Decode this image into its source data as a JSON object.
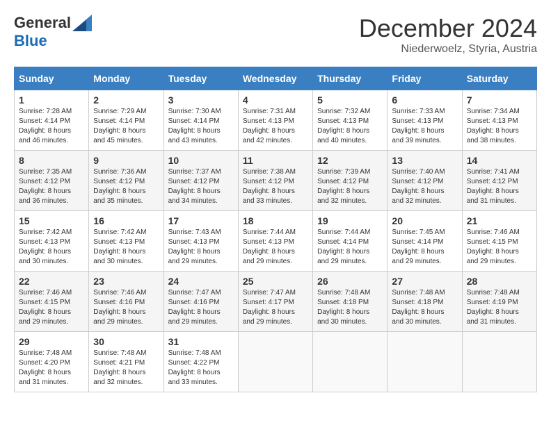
{
  "header": {
    "logo_general": "General",
    "logo_blue": "Blue",
    "month_title": "December 2024",
    "subtitle": "Niederwoelz, Styria, Austria"
  },
  "weekdays": [
    "Sunday",
    "Monday",
    "Tuesday",
    "Wednesday",
    "Thursday",
    "Friday",
    "Saturday"
  ],
  "weeks": [
    [
      {
        "day": "1",
        "sunrise": "7:28 AM",
        "sunset": "4:14 PM",
        "daylight": "8 hours and 46 minutes."
      },
      {
        "day": "2",
        "sunrise": "7:29 AM",
        "sunset": "4:14 PM",
        "daylight": "8 hours and 45 minutes."
      },
      {
        "day": "3",
        "sunrise": "7:30 AM",
        "sunset": "4:14 PM",
        "daylight": "8 hours and 43 minutes."
      },
      {
        "day": "4",
        "sunrise": "7:31 AM",
        "sunset": "4:13 PM",
        "daylight": "8 hours and 42 minutes."
      },
      {
        "day": "5",
        "sunrise": "7:32 AM",
        "sunset": "4:13 PM",
        "daylight": "8 hours and 40 minutes."
      },
      {
        "day": "6",
        "sunrise": "7:33 AM",
        "sunset": "4:13 PM",
        "daylight": "8 hours and 39 minutes."
      },
      {
        "day": "7",
        "sunrise": "7:34 AM",
        "sunset": "4:13 PM",
        "daylight": "8 hours and 38 minutes."
      }
    ],
    [
      {
        "day": "8",
        "sunrise": "7:35 AM",
        "sunset": "4:12 PM",
        "daylight": "8 hours and 36 minutes."
      },
      {
        "day": "9",
        "sunrise": "7:36 AM",
        "sunset": "4:12 PM",
        "daylight": "8 hours and 35 minutes."
      },
      {
        "day": "10",
        "sunrise": "7:37 AM",
        "sunset": "4:12 PM",
        "daylight": "8 hours and 34 minutes."
      },
      {
        "day": "11",
        "sunrise": "7:38 AM",
        "sunset": "4:12 PM",
        "daylight": "8 hours and 33 minutes."
      },
      {
        "day": "12",
        "sunrise": "7:39 AM",
        "sunset": "4:12 PM",
        "daylight": "8 hours and 32 minutes."
      },
      {
        "day": "13",
        "sunrise": "7:40 AM",
        "sunset": "4:12 PM",
        "daylight": "8 hours and 32 minutes."
      },
      {
        "day": "14",
        "sunrise": "7:41 AM",
        "sunset": "4:12 PM",
        "daylight": "8 hours and 31 minutes."
      }
    ],
    [
      {
        "day": "15",
        "sunrise": "7:42 AM",
        "sunset": "4:13 PM",
        "daylight": "8 hours and 30 minutes."
      },
      {
        "day": "16",
        "sunrise": "7:42 AM",
        "sunset": "4:13 PM",
        "daylight": "8 hours and 30 minutes."
      },
      {
        "day": "17",
        "sunrise": "7:43 AM",
        "sunset": "4:13 PM",
        "daylight": "8 hours and 29 minutes."
      },
      {
        "day": "18",
        "sunrise": "7:44 AM",
        "sunset": "4:13 PM",
        "daylight": "8 hours and 29 minutes."
      },
      {
        "day": "19",
        "sunrise": "7:44 AM",
        "sunset": "4:14 PM",
        "daylight": "8 hours and 29 minutes."
      },
      {
        "day": "20",
        "sunrise": "7:45 AM",
        "sunset": "4:14 PM",
        "daylight": "8 hours and 29 minutes."
      },
      {
        "day": "21",
        "sunrise": "7:46 AM",
        "sunset": "4:15 PM",
        "daylight": "8 hours and 29 minutes."
      }
    ],
    [
      {
        "day": "22",
        "sunrise": "7:46 AM",
        "sunset": "4:15 PM",
        "daylight": "8 hours and 29 minutes."
      },
      {
        "day": "23",
        "sunrise": "7:46 AM",
        "sunset": "4:16 PM",
        "daylight": "8 hours and 29 minutes."
      },
      {
        "day": "24",
        "sunrise": "7:47 AM",
        "sunset": "4:16 PM",
        "daylight": "8 hours and 29 minutes."
      },
      {
        "day": "25",
        "sunrise": "7:47 AM",
        "sunset": "4:17 PM",
        "daylight": "8 hours and 29 minutes."
      },
      {
        "day": "26",
        "sunrise": "7:48 AM",
        "sunset": "4:18 PM",
        "daylight": "8 hours and 30 minutes."
      },
      {
        "day": "27",
        "sunrise": "7:48 AM",
        "sunset": "4:18 PM",
        "daylight": "8 hours and 30 minutes."
      },
      {
        "day": "28",
        "sunrise": "7:48 AM",
        "sunset": "4:19 PM",
        "daylight": "8 hours and 31 minutes."
      }
    ],
    [
      {
        "day": "29",
        "sunrise": "7:48 AM",
        "sunset": "4:20 PM",
        "daylight": "8 hours and 31 minutes."
      },
      {
        "day": "30",
        "sunrise": "7:48 AM",
        "sunset": "4:21 PM",
        "daylight": "8 hours and 32 minutes."
      },
      {
        "day": "31",
        "sunrise": "7:48 AM",
        "sunset": "4:22 PM",
        "daylight": "8 hours and 33 minutes."
      },
      null,
      null,
      null,
      null
    ]
  ],
  "labels": {
    "sunrise": "Sunrise:",
    "sunset": "Sunset:",
    "daylight": "Daylight:"
  }
}
